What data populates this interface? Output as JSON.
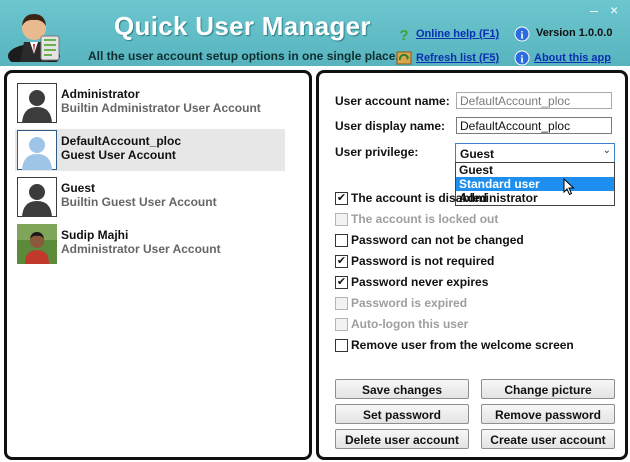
{
  "header": {
    "title": "Quick User Manager",
    "tagline": "All the user account setup options in one single place.",
    "online_help": "Online help (F1)",
    "refresh": "Refresh list (F5)",
    "version": "Version 1.0.0.0",
    "about": "About this app",
    "minimize_glyph": "–",
    "close_glyph": "×"
  },
  "users": [
    {
      "name": "Administrator",
      "desc": "Builtin Administrator User Account"
    },
    {
      "name": "DefaultAccount_ploc",
      "desc": "Guest User Account"
    },
    {
      "name": "Guest",
      "desc": "Builtin Guest User Account"
    },
    {
      "name": "Sudip Majhi",
      "desc": "Administrator User Account"
    }
  ],
  "form": {
    "account_name_label": "User account name:",
    "account_name_value": "DefaultAccount_ploc",
    "display_name_label": "User display name:",
    "display_name_value": "DefaultAccount_ploc",
    "privilege_label": "User privilege:",
    "privilege_value": "Guest",
    "privilege_options": [
      "Guest",
      "Standard user",
      "Administrator"
    ]
  },
  "checkboxes": [
    {
      "label": "The account is disabled",
      "checked": true,
      "enabled": true
    },
    {
      "label": "The account is locked out",
      "checked": false,
      "enabled": false
    },
    {
      "label": "Password can not be changed",
      "checked": false,
      "enabled": true
    },
    {
      "label": "Password is not required",
      "checked": true,
      "enabled": true
    },
    {
      "label": "Password never expires",
      "checked": true,
      "enabled": true
    },
    {
      "label": "Password is expired",
      "checked": false,
      "enabled": false
    },
    {
      "label": "Auto-logon this user",
      "checked": false,
      "enabled": false
    },
    {
      "label": "Remove user from the welcome screen",
      "checked": false,
      "enabled": true
    }
  ],
  "buttons": {
    "save": "Save changes",
    "change_picture": "Change picture",
    "set_password": "Set password",
    "remove_password": "Remove password",
    "delete_user": "Delete user account",
    "create_user": "Create user account"
  },
  "colors": {
    "header_bg": "#5ab7c1",
    "link": "#0b2fb3",
    "dropdown_highlight": "#1e8fef",
    "selected_row": "#e7e7e7"
  },
  "icons": {
    "app": "user-manager-icon",
    "help": "question-mark-icon",
    "refresh": "refresh-icon",
    "info": "info-icon",
    "avatar": "user-silhouette-icon",
    "photo": "user-photo-icon"
  }
}
